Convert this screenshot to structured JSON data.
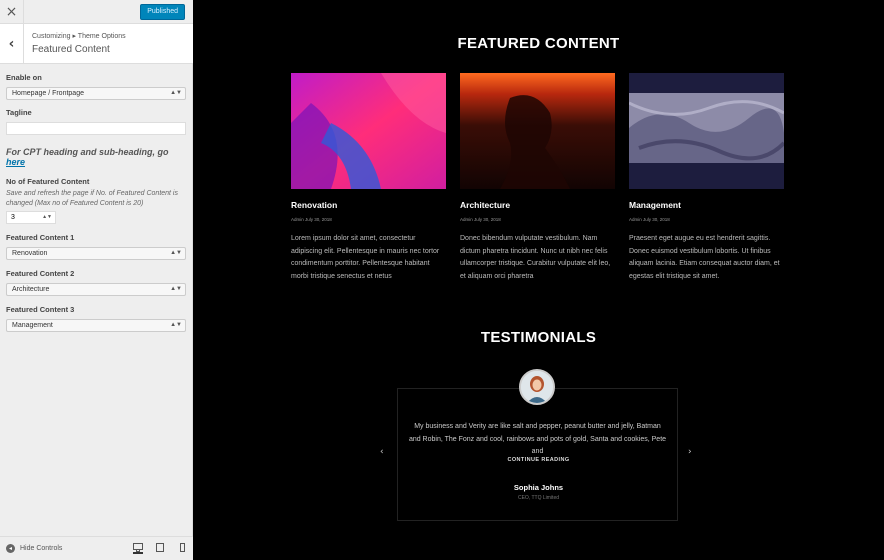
{
  "topbar": {
    "close_icon": "×",
    "publish_label": "Published"
  },
  "section": {
    "back_icon": "‹",
    "breadcrumb": "Customizing ▸ Theme Options",
    "title": "Featured Content"
  },
  "controls": {
    "enable_on": {
      "label": "Enable on",
      "value": "Homepage / Frontpage"
    },
    "tagline": {
      "label": "Tagline",
      "value": ""
    },
    "cpt_note": {
      "text": "For CPT heading and sub-heading, go ",
      "link": "here"
    },
    "count": {
      "label": "No of Featured Content",
      "description": "Save and refresh the page if No. of Featured Content is changed (Max no of Featured Content is 20)",
      "value": "3"
    },
    "content_1": {
      "label": "Featured Content 1",
      "value": "Renovation"
    },
    "content_2": {
      "label": "Featured Content 2",
      "value": "Architecture"
    },
    "content_3": {
      "label": "Featured Content 3",
      "value": "Management"
    }
  },
  "footer": {
    "hide_label": "Hide Controls",
    "devices": [
      "desktop-icon",
      "tablet-icon",
      "mobile-icon"
    ]
  },
  "preview": {
    "featured_heading": "FEATURED CONTENT",
    "cards": [
      {
        "title": "Renovation",
        "meta": "Admin      July 30, 2018",
        "text": "Lorem ipsum dolor sit amet, consectetur adipiscing elit. Pellentesque in mauris nec tortor condimentum porttitor. Pellentesque habitant morbi tristique senectus et netus"
      },
      {
        "title": "Architecture",
        "meta": "Admin      July 30, 2018",
        "text": "Donec bibendum vulputate vestibulum. Nam dictum pharetra tincidunt. Nunc ut nibh nec felis ullamcorper tristique. Curabitur vulputate elit leo, et aliquam orci pharetra"
      },
      {
        "title": "Management",
        "meta": "Admin      July 30, 2018",
        "text": "Praesent eget augue eu est hendrerit sagittis. Donec euismod vestibulum lobortis. Ut finibus aliquam lacinia. Etiam consequat auctor diam, et egestas elit tristique sit amet."
      }
    ],
    "testimonials_heading": "TESTIMONIALS",
    "testimonial": {
      "quote": "My business and Verity are like salt and pepper, peanut butter and jelly, Batman and Robin, The Fonz and cool, rainbows and pots of gold, Santa and cookies, Pete and",
      "continue_label": "CONTINUE READING",
      "name": "Sophia Johns",
      "role": "CEO, TTQ Limited"
    },
    "prev_icon": "‹",
    "next_icon": "›"
  },
  "colors": {
    "publish": "#0085ba",
    "link": "#0073aa",
    "preview_bg": "#000000"
  }
}
